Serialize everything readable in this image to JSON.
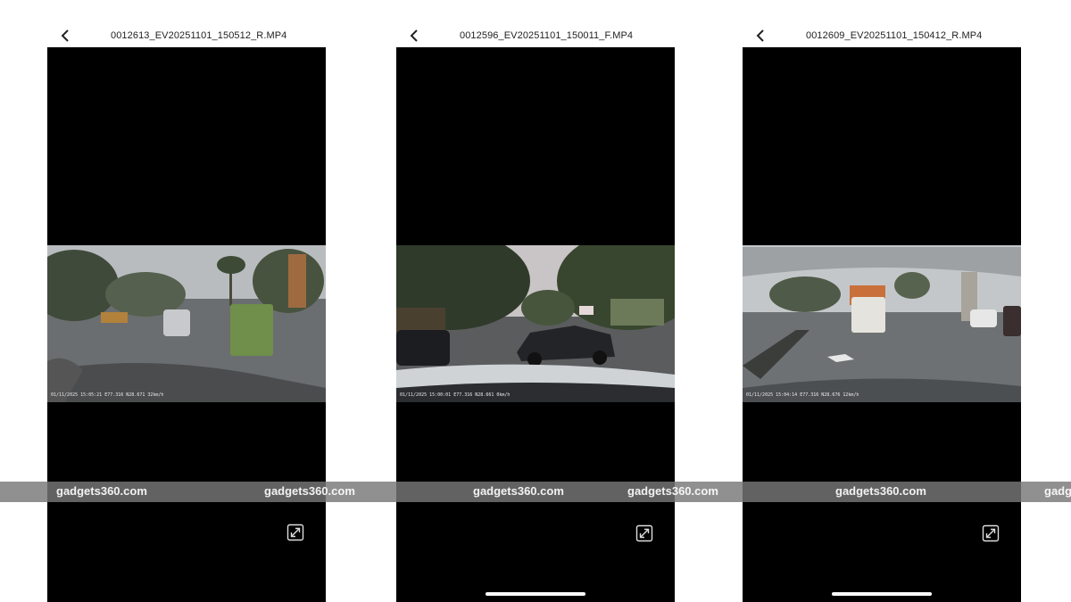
{
  "panels": [
    {
      "title": "0012613_EV20251101_150512_R.MP4",
      "overlay": "01/11/2025 15:05:21 E77.316 N28.671 32km/h"
    },
    {
      "title": "0012596_EV20251101_150011_F.MP4",
      "overlay": "01/11/2025 15:00:01 E77.316 N28.661 0km/h"
    },
    {
      "title": "0012609_EV20251101_150412_R.MP4",
      "overlay": "01/11/2025 15:04:14 E77.316 N28.676 12km/h"
    }
  ],
  "watermark": "gadgets360.com",
  "icons": {
    "back": "chevron-left-icon",
    "expand": "expand-arrows-icon"
  },
  "colors": {
    "screen": "#000000",
    "background": "#ffffff",
    "watermark_band": "#787878"
  }
}
